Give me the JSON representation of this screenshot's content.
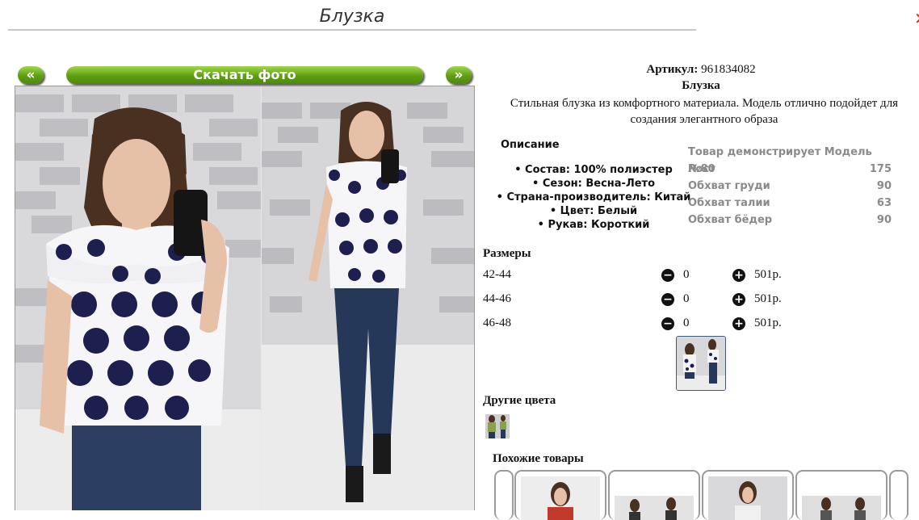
{
  "page": {
    "title": "Блузка"
  },
  "nav": {
    "prev_label": "«",
    "next_label": "»",
    "download_label": "Скачать фото"
  },
  "product": {
    "article_label": "Артикул:",
    "article_value": "961834082",
    "name": "Блузка",
    "description": "Стильная блузка из комфортного материала. Модель отлично подойдет для создания элегантного образа"
  },
  "details": {
    "heading": "Описание",
    "items": [
      "Состав: 100% полиэстер",
      "Сезон: Весна-Лето",
      "Страна-производитель: Китай",
      "Цвет: Белый",
      "Рукав: Короткий"
    ]
  },
  "model": {
    "rows": [
      {
        "label": "Товар демонстрирует Модель №80",
        "value": ""
      },
      {
        "label": "Рост",
        "value": "175"
      },
      {
        "label": "Обхват груди",
        "value": "90"
      },
      {
        "label": "Обхват талии",
        "value": "63"
      },
      {
        "label": "Обхват бёдер",
        "value": "90"
      }
    ]
  },
  "sizes": {
    "heading": "Размеры",
    "rows": [
      {
        "label": "42-44",
        "qty": "0",
        "price": "501р."
      },
      {
        "label": "44-46",
        "qty": "0",
        "price": "501р."
      },
      {
        "label": "46-48",
        "qty": "0",
        "price": "501р."
      }
    ],
    "minus_symbol": "−",
    "plus_symbol": "+"
  },
  "other_colors": {
    "heading": "Другие цвета"
  },
  "similar": {
    "heading": "Похожие товары"
  },
  "colors": {
    "accent_green": "#5f9e13",
    "model_gray": "#8a8a8a",
    "corner_red": "#d62a1e"
  }
}
